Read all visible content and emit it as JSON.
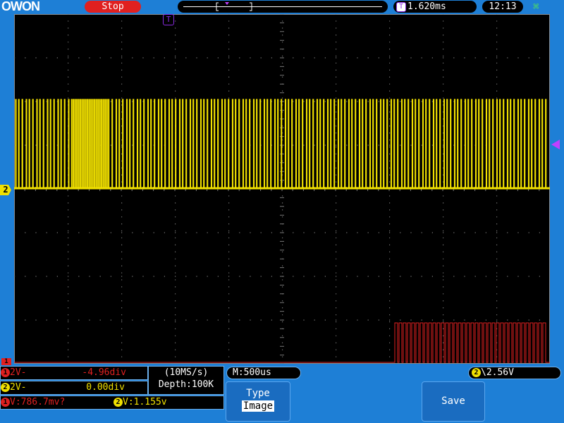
{
  "header": {
    "logo": "OWON",
    "run_state": "Stop",
    "trigger_delay": "1.620ms",
    "time": "12:13",
    "trigger_badge": "T",
    "usb_icon": "usb-icon"
  },
  "markers": {
    "ch2_label": "2",
    "ch1_label": "1",
    "trigger_position": "T"
  },
  "channels": {
    "ch1": {
      "num": "1",
      "scale": "2V-",
      "offset": "-4.96div",
      "color": "#e02020"
    },
    "ch2": {
      "num": "2",
      "scale": "2V-",
      "offset": "0.00div",
      "color": "#f0e000"
    }
  },
  "acquisition": {
    "sample_rate": "(10MS/s)",
    "depth": "Depth:100K",
    "timebase": "M:500us"
  },
  "trigger": {
    "channel": "2",
    "edge_symbol": "\\",
    "level": "2.56V"
  },
  "measurements": {
    "ch1_value": "V:786.7mv?",
    "ch2_value": "V:1.155v"
  },
  "menu": {
    "type_label": "Type",
    "type_value": "Image",
    "save_label": "Save"
  },
  "colors": {
    "background": "#1e7fd6",
    "screen": "#000000",
    "ch1": "#e02020",
    "ch2": "#f0e000",
    "trigger": "#c040ff",
    "stop": "#e02020"
  }
}
